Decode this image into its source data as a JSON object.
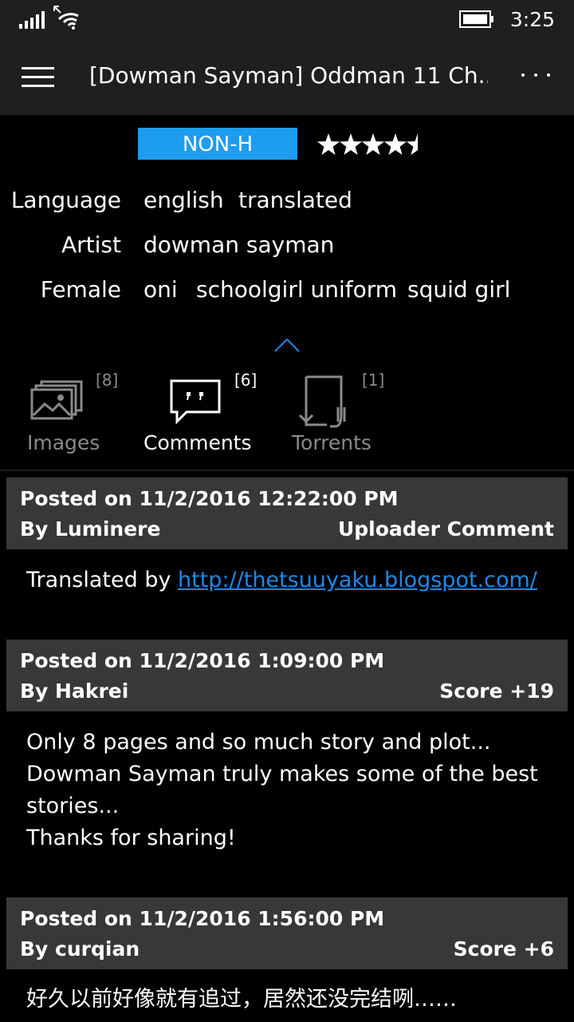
{
  "status_bar": {
    "time": "3:25",
    "icons": [
      "signal-icon",
      "wifi-icon",
      "battery-icon"
    ]
  },
  "header": {
    "title": "[Dowman Sayman] Oddman 11 Ch....",
    "menu_icon": "hamburger-icon",
    "more_icon": "more-icon"
  },
  "gallery": {
    "category": "NON-H",
    "rating": 4.5,
    "tags": [
      {
        "label": "Language",
        "values": [
          "english",
          "translated"
        ]
      },
      {
        "label": "Artist",
        "values": [
          "dowman sayman"
        ]
      },
      {
        "label": "Female",
        "values": [
          "oni",
          "schoolgirl uniform",
          "squid girl"
        ]
      }
    ]
  },
  "tabs": [
    {
      "label": "Images",
      "count": "[8]",
      "icon": "images-icon",
      "active": false
    },
    {
      "label": "Comments",
      "count": "[6]",
      "icon": "comments-icon",
      "active": true
    },
    {
      "label": "Torrents",
      "count": "[1]",
      "icon": "torrents-icon",
      "active": false
    }
  ],
  "comments": [
    {
      "posted": "Posted on 11/2/2016 12:22:00 PM",
      "by": "By Luminere",
      "meta": "Uploader Comment",
      "text_prefix": "Translated by ",
      "link": "http://thetsuuyaku.blogspot.com/"
    },
    {
      "posted": "Posted on 11/2/2016 1:09:00 PM",
      "by": "By Hakrei",
      "meta": "Score +19",
      "lines": [
        "Only 8 pages and so much story and plot...",
        "Dowman Sayman truly makes some of the best",
        "stories...",
        "Thanks for sharing!"
      ]
    },
    {
      "posted": "Posted on 11/2/2016 1:56:00 PM",
      "by": "By curqian",
      "meta": "Score +6",
      "lines": [
        "好久以前好像就有追过，居然还没完结咧……"
      ]
    }
  ],
  "colors": {
    "accent": "#1e9cf0",
    "link": "#1e88e5",
    "comment_header": "#383838",
    "chrome": "#1f1f1f"
  }
}
